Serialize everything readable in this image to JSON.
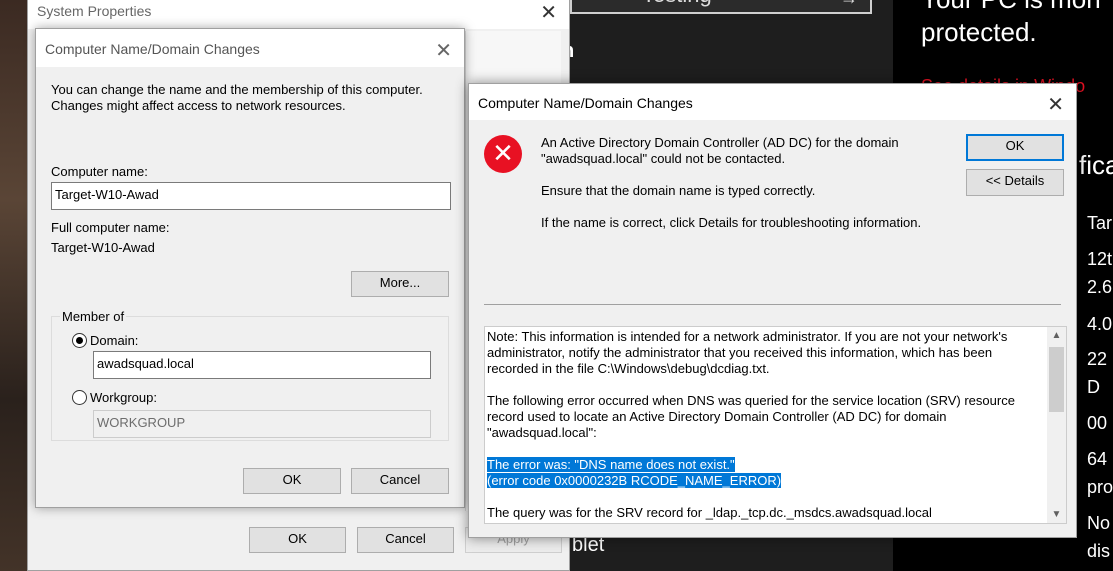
{
  "background": {
    "search_text": "Testing",
    "frag_n": "n",
    "frag_blet": "blet",
    "right_protected_1": "Your PC is mon",
    "right_protected_2": "protected.",
    "right_link": "See details in Windo",
    "right_heading": "fica",
    "right_lines": [
      "Tar",
      "12t",
      "2.6",
      "4.0",
      "22",
      "D",
      "00",
      "64",
      "pro",
      "No",
      "dis"
    ]
  },
  "system_properties": {
    "title": "System Properties",
    "ok_label": "OK",
    "cancel_label": "Cancel",
    "apply_label": "Apply"
  },
  "name_changes": {
    "title": "Computer Name/Domain Changes",
    "intro": "You can change the name and the membership of this computer. Changes might affect access to network resources.",
    "computer_name_label": "Computer name:",
    "computer_name_value": "Target-W10-Awad",
    "full_name_label": "Full computer name:",
    "full_name_value": "Target-W10-Awad",
    "more_label": "More...",
    "member_of_label": "Member of",
    "domain_label": "Domain:",
    "domain_value": "awadsquad.local",
    "workgroup_label": "Workgroup:",
    "workgroup_value": "WORKGROUP",
    "selected": "domain",
    "ok_label": "OK",
    "cancel_label": "Cancel"
  },
  "error_dialog": {
    "title": "Computer Name/Domain Changes",
    "icon": "error-icon",
    "message_1": "An Active Directory Domain Controller (AD DC) for the domain \"awadsquad.local\" could not be contacted.",
    "message_2": "Ensure that the domain name is typed correctly.",
    "message_3": "If the name is correct, click Details for troubleshooting information.",
    "ok_label": "OK",
    "details_label": "<< Details",
    "details_text": {
      "p1": "Note: This information is intended for a network administrator.  If you are not your network's administrator, notify the administrator that you received this information, which has been recorded in the file C:\\Windows\\debug\\dcdiag.txt.",
      "p2": "The following error occurred when DNS was queried for the service location (SRV) resource record used to locate an Active Directory Domain Controller (AD DC) for domain \"awadsquad.local\":",
      "p3_line1": "The error was: \"DNS name does not exist.\"",
      "p3_line2": "(error code 0x0000232B RCODE_NAME_ERROR)",
      "p4": "The query was for the SRV record for _ldap._tcp.dc._msdcs.awadsquad.local"
    }
  }
}
